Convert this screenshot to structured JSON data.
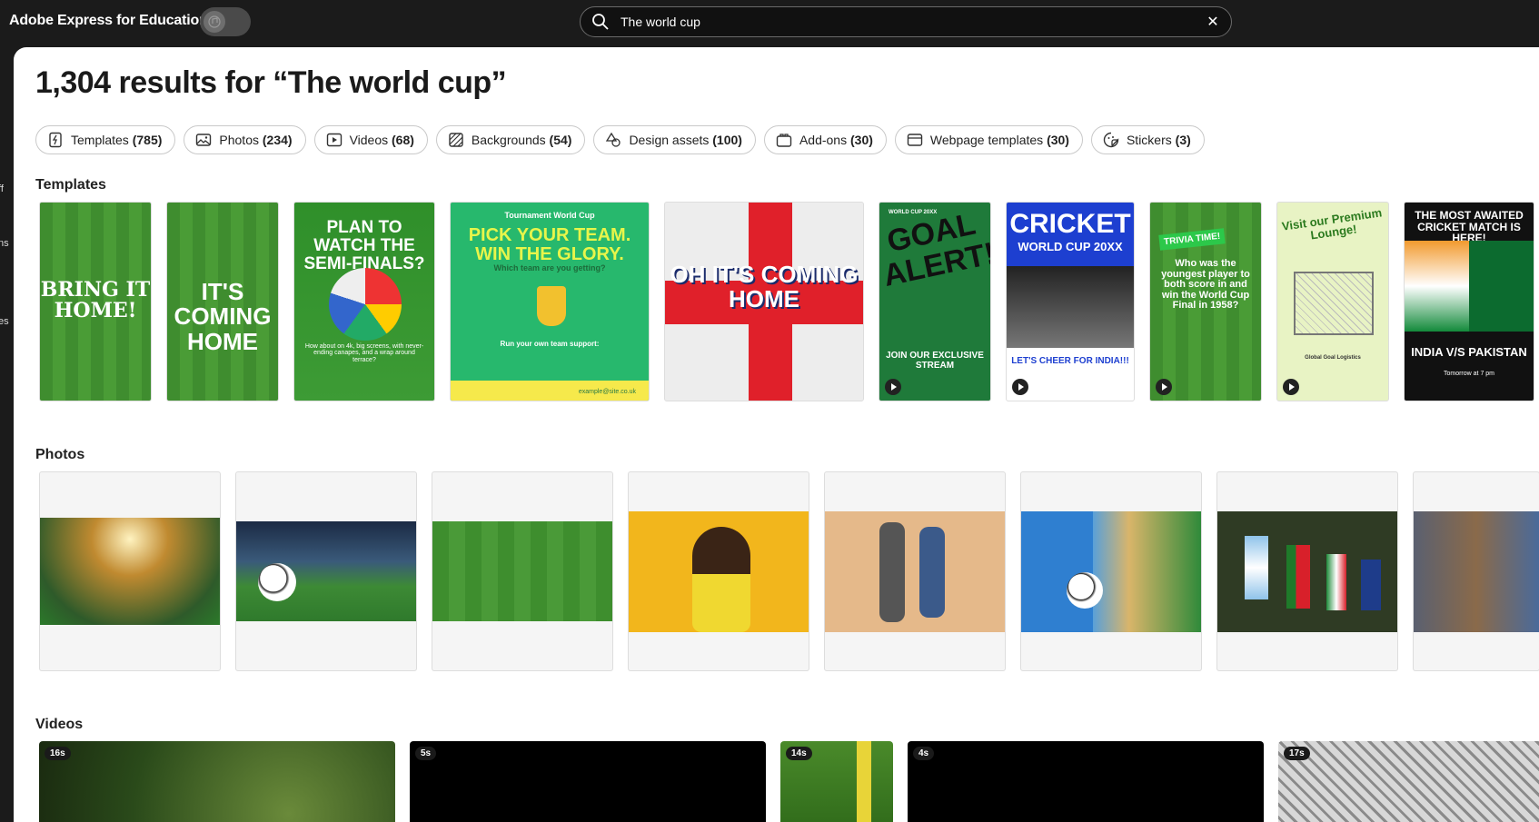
{
  "app": {
    "title": "Adobe Express for Education"
  },
  "search": {
    "value": "The world cup",
    "clear_label": "✕"
  },
  "left_rail": {
    "fragments": [
      "ff",
      "ns",
      "es"
    ]
  },
  "results": {
    "title": "1,304 results for “The world cup”"
  },
  "chips": [
    {
      "label": "Templates",
      "count": "(785)",
      "icon": "template-icon"
    },
    {
      "label": "Photos",
      "count": "(234)",
      "icon": "photo-icon"
    },
    {
      "label": "Videos",
      "count": "(68)",
      "icon": "video-icon"
    },
    {
      "label": "Backgrounds",
      "count": "(54)",
      "icon": "background-icon"
    },
    {
      "label": "Design assets",
      "count": "(100)",
      "icon": "design-assets-icon"
    },
    {
      "label": "Add-ons",
      "count": "(30)",
      "icon": "addons-icon"
    },
    {
      "label": "Webpage templates",
      "count": "(30)",
      "icon": "webpage-icon"
    },
    {
      "label": "Stickers",
      "count": "(3)",
      "icon": "sticker-icon"
    }
  ],
  "sections": {
    "templates": "Templates",
    "photos": "Photos",
    "videos": "Videos"
  },
  "templates": [
    {
      "text": "BRING IT HOME!"
    },
    {
      "text": "IT'S COMING HOME"
    },
    {
      "text": "PLAN TO WATCH THE SEMI-FINALS?",
      "sub": "How about on 4k, big screens, with never-ending canapes, and a wrap around terrace?"
    },
    {
      "text": "PICK YOUR TEAM. WIN THE GLORY.",
      "top": "Tournament World Cup",
      "sub": "Which team are you getting?",
      "foot": "Run your own team support:",
      "email": "example@site.co.uk"
    },
    {
      "text": "OH IT'S COMING HOME"
    },
    {
      "text": "GOAL ALERT!",
      "top": "WORLD CUP 20XX",
      "sub": "JOIN OUR EXCLUSIVE STREAM"
    },
    {
      "text": "CRICKET",
      "sub": "WORLD CUP 20XX",
      "foot": "LET'S CHEER FOR INDIA!!!"
    },
    {
      "text": "Who was the youngest player to both score in and win the World Cup Final in 1958?",
      "top": "TRIVIA TIME!"
    },
    {
      "text": "Visit our Premium Lounge!",
      "sub": "Global Goal Logistics"
    },
    {
      "text": "THE MOST AWAITED CRICKET MATCH IS HERE!",
      "sub": "INDIA V/S PAKISTAN",
      "foot": "Tomorrow at 7 pm"
    }
  ],
  "videos": [
    {
      "duration": "16s"
    },
    {
      "duration": "5s"
    },
    {
      "duration": "14s"
    },
    {
      "duration": "4s"
    },
    {
      "duration": "17s"
    }
  ]
}
